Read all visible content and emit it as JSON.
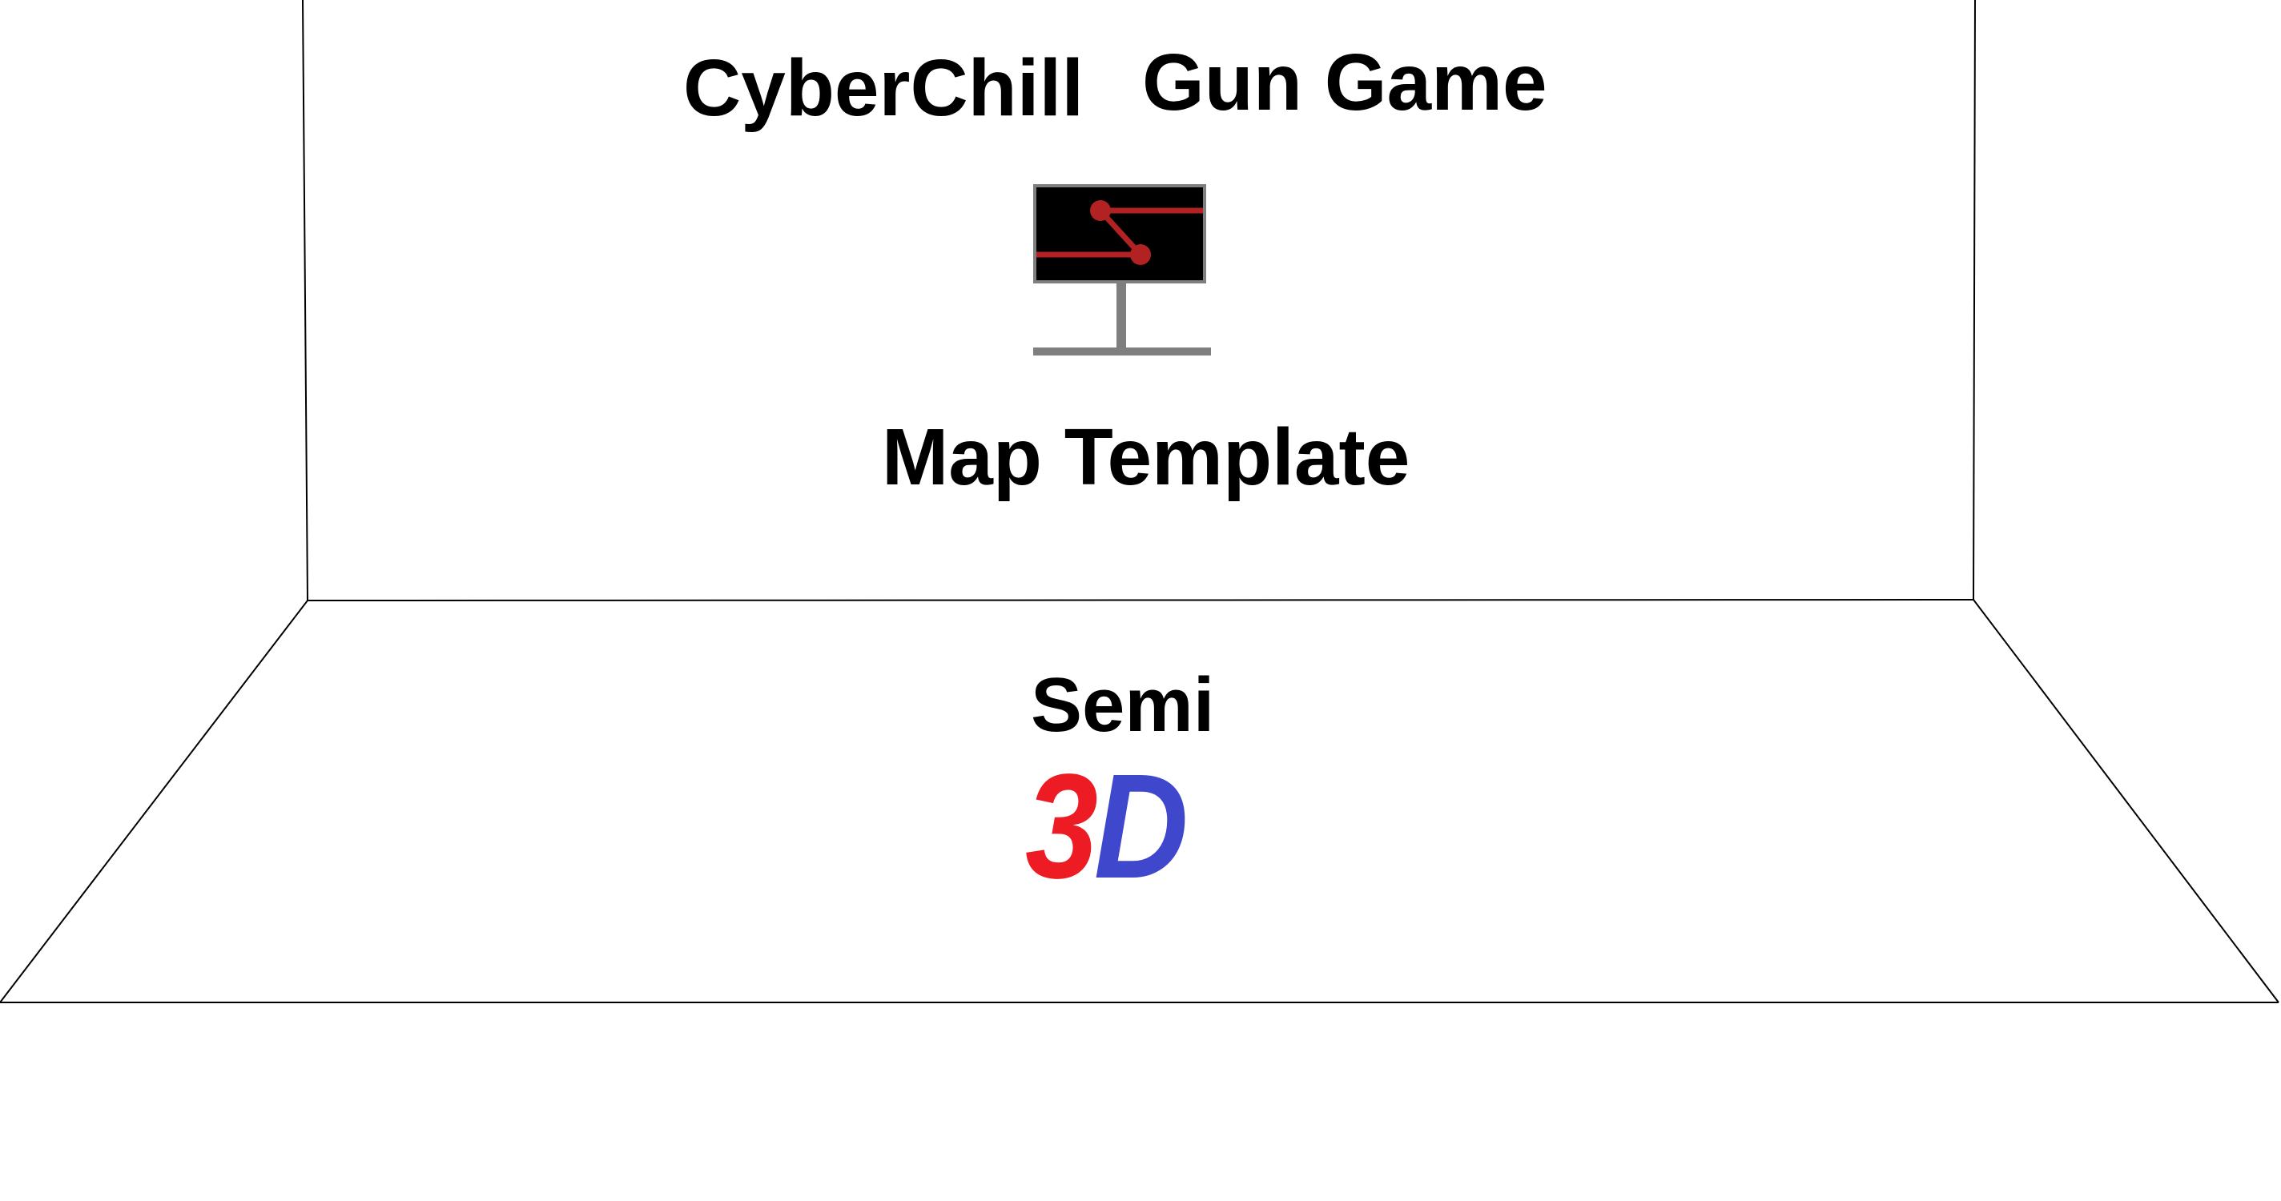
{
  "title": {
    "left_word": "CyberChill",
    "right_words": "Gun Game"
  },
  "map_template": {
    "label": "Map Template",
    "icon": "map-sign-icon"
  },
  "mode_badge": {
    "label": "Semi",
    "logo_digit": "3",
    "logo_letter": "D"
  },
  "colors": {
    "background": "#ffffff",
    "text": "#000000",
    "room_lines": "#000000",
    "sign_screen": "#000000",
    "sign_frame": "#7f7f7f",
    "sign_route": "#b22222",
    "logo_digit_color": "#ed1c24",
    "logo_letter_color": "#3f48cc"
  }
}
